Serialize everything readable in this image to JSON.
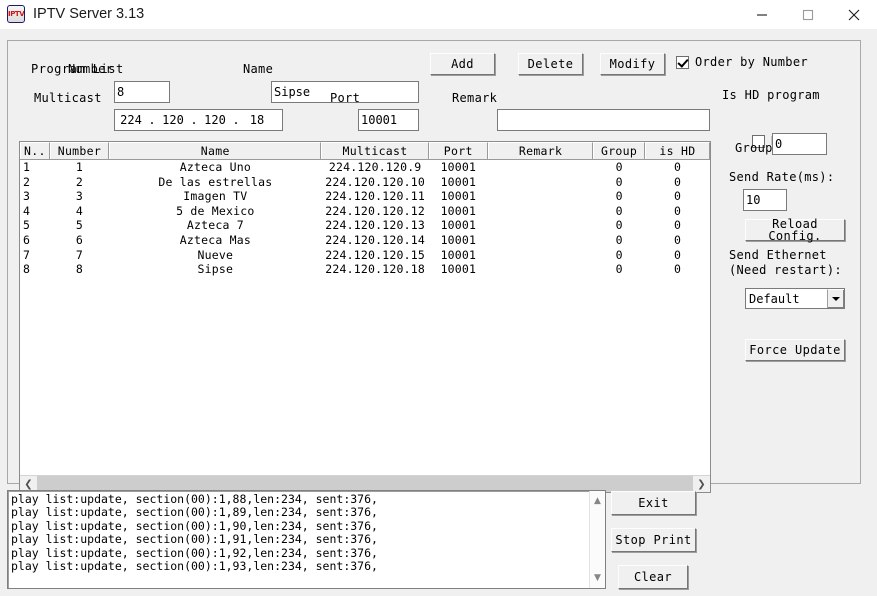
{
  "window": {
    "title": "IPTV Server 3.13",
    "icon_text": "IPTV",
    "minimize_label": "Minimize",
    "maximize_label": "Maximize",
    "close_label": "Close"
  },
  "program_list": {
    "group_title": "Program List",
    "fields": {
      "number_label": "Number",
      "number_value": "8",
      "name_label": "Name",
      "name_value": "Sipse",
      "multicast_label": "Multicast",
      "multicast_octets": [
        "224",
        "120",
        "120",
        "18"
      ],
      "multicast_separator": ".",
      "port_label": "Port",
      "port_value": "10001",
      "remark_label": "Remark",
      "remark_value": ""
    },
    "buttons": {
      "add": "Add",
      "delete": "Delete",
      "modify": "Modify"
    },
    "order_by_number": {
      "label": "Order by Number",
      "checked": true
    },
    "table": {
      "columns": [
        "N..",
        "Number",
        "Name",
        "Multicast",
        "Port",
        "Remark",
        "Group",
        "is HD"
      ],
      "rows": [
        [
          "1",
          "1",
          "Azteca Uno",
          "224.120.120.9",
          "10001",
          "",
          "0",
          "0"
        ],
        [
          "2",
          "2",
          "De las estrellas",
          "224.120.120.10",
          "10001",
          "",
          "0",
          "0"
        ],
        [
          "3",
          "3",
          "Imagen TV",
          "224.120.120.11",
          "10001",
          "",
          "0",
          "0"
        ],
        [
          "4",
          "4",
          "5 de Mexico",
          "224.120.120.12",
          "10001",
          "",
          "0",
          "0"
        ],
        [
          "5",
          "5",
          "Azteca 7",
          "224.120.120.13",
          "10001",
          "",
          "0",
          "0"
        ],
        [
          "6",
          "6",
          "Azteca Mas",
          "224.120.120.14",
          "10001",
          "",
          "0",
          "0"
        ],
        [
          "7",
          "7",
          "Nueve",
          "224.120.120.15",
          "10001",
          "",
          "0",
          "0"
        ],
        [
          "8",
          "8",
          "Sipse",
          "224.120.120.18",
          "10001",
          "",
          "0",
          "0"
        ]
      ]
    }
  },
  "side_panel": {
    "is_hd_program_label": "Is HD program",
    "hd_checkbox": {
      "label": "HD",
      "checked": false
    },
    "group_label": "Group",
    "group_value": "0",
    "send_rate_label": "Send Rate(ms):",
    "send_rate_value": "10",
    "reload_config_button": "Reload Config.",
    "send_ethernet_label_line1": "Send Ethernet",
    "send_ethernet_label_line2": "(Need restart):",
    "ethernet_selected": "Default",
    "force_update_button": "Force Update"
  },
  "log": {
    "lines": [
      "play list:update, section(00):1,88,len:234, sent:376,",
      "play list:update, section(00):1,89,len:234, sent:376,",
      "play list:update, section(00):1,90,len:234, sent:376,",
      "play list:update, section(00):1,91,len:234, sent:376,",
      "play list:update, section(00):1,92,len:234, sent:376,",
      "play list:update, section(00):1,93,len:234, sent:376,"
    ]
  },
  "bottom_buttons": {
    "exit": "Exit",
    "stop_print": "Stop Print",
    "clear": "Clear"
  },
  "colors": {
    "window_bg": "#f0f0f0",
    "titlebar_bg": "#ffffff",
    "field_bg": "#ffffff",
    "border": "#7a7a7a",
    "icon_red": "#d01717"
  }
}
